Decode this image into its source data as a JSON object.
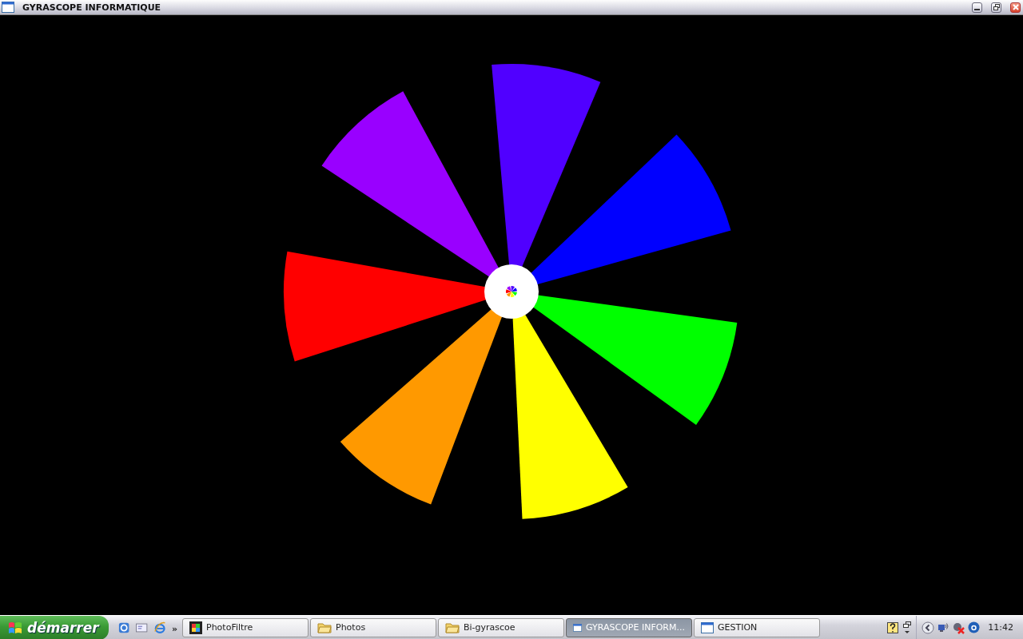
{
  "window": {
    "title": "GYRASCOPE INFORMATIQUE"
  },
  "pinwheel": {
    "sectors": [
      {
        "color": "#5000ff"
      },
      {
        "color": "#0000ff"
      },
      {
        "color": "#00ff00"
      },
      {
        "color": "#ffff00"
      },
      {
        "color": "#ff9900"
      },
      {
        "color": "#ff0000"
      },
      {
        "color": "#9900ff"
      }
    ]
  },
  "taskbar": {
    "start": "démarrer",
    "more": "»",
    "tasks": [
      {
        "label": "PhotoFiltre",
        "kind": "app",
        "selected": false
      },
      {
        "label": "Photos",
        "kind": "folder",
        "selected": false
      },
      {
        "label": "Bi-gyrascoe",
        "kind": "folder",
        "selected": false
      },
      {
        "label": "GYRASCOPE INFORM...",
        "kind": "window",
        "selected": true
      },
      {
        "label": "GESTION",
        "kind": "window",
        "selected": false
      }
    ],
    "clock": "11:42"
  }
}
